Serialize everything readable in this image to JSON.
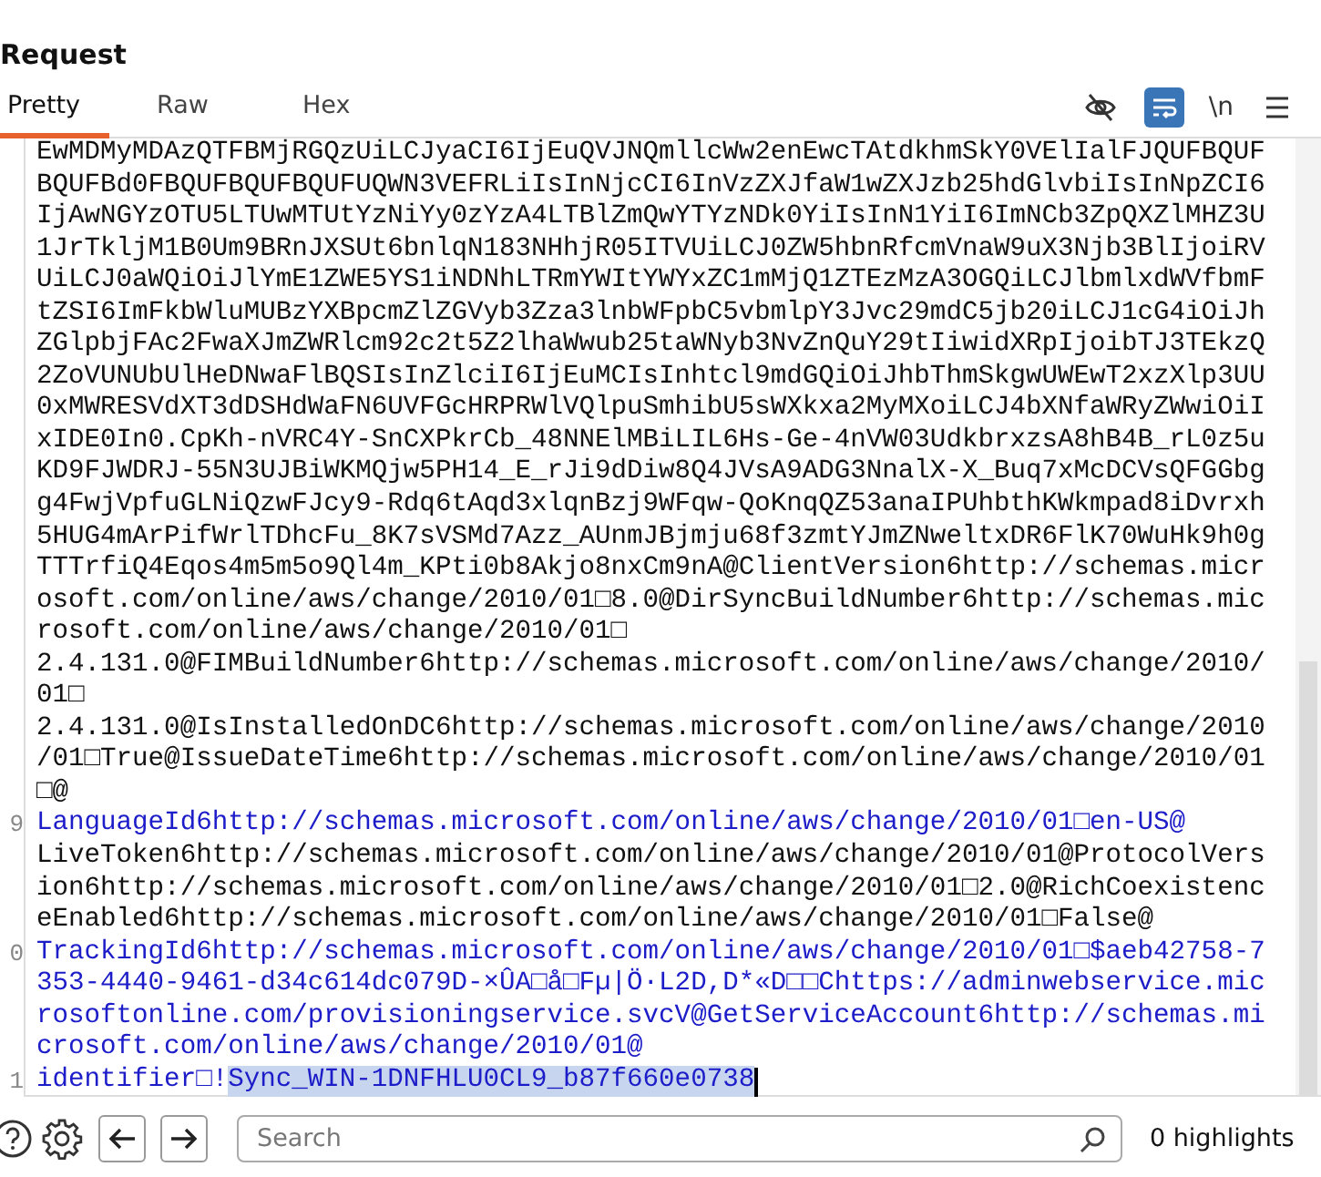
{
  "panel": {
    "title": "Request"
  },
  "tabs": [
    {
      "label": "Pretty",
      "selected": true
    },
    {
      "label": "Raw",
      "selected": false
    },
    {
      "label": "Hex",
      "selected": false
    }
  ],
  "toolbar": {
    "wrap_on": true,
    "newline_label": "\\n"
  },
  "rows": [
    {
      "kind": "plain",
      "text": "EwMDMyMDAzQTFBMjRGQzUiLCJyaCI6IjEuQVJNQmllcWw2enEwcTAtdkhmSkY0VElIalFJQUFBQUF"
    },
    {
      "kind": "plain",
      "text": "BQUFBd0FBQUFBQUFBQUFUQWN3VEFRLiIsInNjcCI6InVzZXJfaW1wZXJzb25hdGlvbiIsInNpZCI6"
    },
    {
      "kind": "plain",
      "text": "IjAwNGYzOTU5LTUwMTUtYzNiYy0zYzA4LTBlZmQwYTYzNDk0YiIsInN1YiI6ImNCb3ZpQXZlMHZ3U"
    },
    {
      "kind": "plain",
      "text": "1JrTkljM1B0Um9BRnJXSUt6bnlqN183NHhjR05ITVUiLCJ0ZW5hbnRfcmVnaW9uX3Njb3BlIjoiRV"
    },
    {
      "kind": "plain",
      "text": "UiLCJ0aWQiOiJlYmE1ZWE5YS1iNDNhLTRmYWItYWYxZC1mMjQ1ZTEzMzA3OGQiLCJlbmlxdWVfbmF"
    },
    {
      "kind": "plain",
      "text": "tZSI6ImFkbWluMUBzYXBpcmZlZGVyb3Zza3lnbWFpbC5vbmlpY3Jvc29mdC5jb20iLCJ1cG4iOiJh"
    },
    {
      "kind": "plain",
      "text": "ZGlpbjFAc2FwaXJmZWRlcm92c2t5Z2lhaWwub25taWNyb3NvZnQuY29tIiwidXRpIjoibTJ3TEkzQ"
    },
    {
      "kind": "plain",
      "text": "2ZoVUNUbUlHeDNwaFlBQSIsInZlciI6IjEuMCIsInhtcl9mdGQiOiJhbThmSkgwUWEwT2xzXlp3UU"
    },
    {
      "kind": "plain",
      "text": "0xMWRESVdXT3dDSHdWaFN6UVFGcHRPRWlVQlpuSmhibU5sWXkxa2MyMXoiLCJ4bXNfaWRyZWwiOiI"
    },
    {
      "kind": "plain",
      "text": "xIDE0In0.CpKh-nVRC4Y-SnCXPkrCb_48NNElMBiLIL6Hs-Ge-4nVW03UdkbrxzsA8hB4B_rL0z5u"
    },
    {
      "kind": "plain",
      "text": "KD9FJWDRJ-55N3UJBiWKMQjw5PH14_E_rJi9dDiw8Q4JVsA9ADG3NnalX-X_Buq7xMcDCVsQFGGbg"
    },
    {
      "kind": "plain",
      "text": "g4FwjVpfuGLNiQzwFJcy9-Rdq6tAqd3xlqnBzj9WFqw-QoKnqQZ53anaIPUhbthKWkmpad8iDvrxh"
    },
    {
      "kind": "plain",
      "text": "5HUG4mArPifWrlTDhcFu_8K7sVSMd7Azz_AUnmJBjmju68f3zmtYJmZNweltxDR6FlK70WuHk9h0g"
    },
    {
      "kind": "plain",
      "text": "TTTrfiQ4Eqos4m5m5o9Ql4m_KPti0b8Akjo8nxCm9nA@ClientVersion6http://schemas.micr"
    },
    {
      "kind": "plain",
      "text": "osoft.com/online/aws/change/2010/01□8.0@DirSyncBuildNumber6http://schemas.mic"
    },
    {
      "kind": "plain",
      "text": "rosoft.com/online/aws/change/2010/01□"
    },
    {
      "kind": "plain",
      "text": "2.4.131.0@FIMBuildNumber6http://schemas.microsoft.com/online/aws/change/2010/"
    },
    {
      "kind": "plain",
      "text": "01□"
    },
    {
      "kind": "plain",
      "text": "2.4.131.0@IsInstalledOnDC6http://schemas.microsoft.com/online/aws/change/2010"
    },
    {
      "kind": "plain",
      "text": "/01□True@IssueDateTime6http://schemas.microsoft.com/online/aws/change/2010/01"
    },
    {
      "kind": "plain",
      "text": "□@"
    },
    {
      "kind": "marked",
      "line_number": "9",
      "text": "LanguageId6http://schemas.microsoft.com/online/aws/change/2010/01□en-US@"
    },
    {
      "kind": "plain",
      "text": "LiveToken6http://schemas.microsoft.com/online/aws/change/2010/01@ProtocolVers"
    },
    {
      "kind": "plain",
      "text": "ion6http://schemas.microsoft.com/online/aws/change/2010/01□2.0@RichCoexistenc"
    },
    {
      "kind": "plain",
      "text": "eEnabled6http://schemas.microsoft.com/online/aws/change/2010/01□False@"
    },
    {
      "kind": "marked",
      "line_number": "0",
      "text": "TrackingId6http://schemas.microsoft.com/online/aws/change/2010/01□$aeb42758-7"
    },
    {
      "kind": "marked",
      "text": "353-4440-9461-d34c614dc079D-×ÛA□å□Fµ|Ö·L2D,D*«D□□Chttps://adminwebservice.mic"
    },
    {
      "kind": "marked",
      "text": "rosoftonline.com/provisioningservice.svcV@GetServiceAccount6http://schemas.mi"
    },
    {
      "kind": "marked",
      "text": "crosoft.com/online/aws/change/2010/01@"
    },
    {
      "kind": "marked",
      "line_number": "1",
      "text": "identifier□!",
      "selection": "Sync_WIN-1DNFHLU0CL9_b87f660e0738"
    }
  ],
  "footer": {
    "search": {
      "placeholder": "Search"
    },
    "highlights": "0 highlights"
  }
}
